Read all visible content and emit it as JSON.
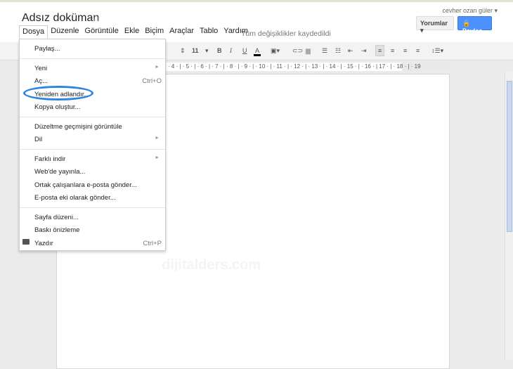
{
  "header": {
    "title": "Adsız doküman",
    "user": "cevher ozan güler ▾",
    "comments": "Yorumlar ▾",
    "share": "🔒 Paylaş",
    "saved": "Tüm değişiklikler kaydedildi"
  },
  "menubar": [
    "Dosya",
    "Düzenle",
    "Görüntüle",
    "Ekle",
    "Biçim",
    "Araçlar",
    "Tablo",
    "Yardım"
  ],
  "toolbar": {
    "font_size": "11",
    "bold": "B",
    "italic": "I",
    "underline": "U",
    "text_color": "A"
  },
  "ruler": "· 4 · | · 5 · | · 6 · | · 7 · | · 8 · | · 9 · | · 10 · | · 11 · | · 12 · | · 13 · | · 14 · | · 15 · | · 16 · | 17 · | · 18 · | · 19",
  "file_menu": {
    "share": "Paylaş...",
    "new": "Yeni",
    "open": "Aç...",
    "open_sc": "Ctrl+O",
    "rename": "Yeniden adlandır...",
    "copy": "Kopya oluştur...",
    "history": "Düzeltme geçmişini görüntüle",
    "language": "Dil",
    "download": "Farklı indir",
    "publish": "Web'de yayınla...",
    "email_collab": "Ortak çalışanlara e-posta gönder...",
    "email_attach": "E-posta eki olarak gönder...",
    "page_setup": "Sayfa düzeni...",
    "print_preview": "Baskı önizleme",
    "print": "Yazdır",
    "print_sc": "Ctrl+P"
  },
  "watermark": "dijitalders.com",
  "colors": {
    "share_button": "#4d90fe",
    "highlight_ring": "#2f84e0"
  }
}
